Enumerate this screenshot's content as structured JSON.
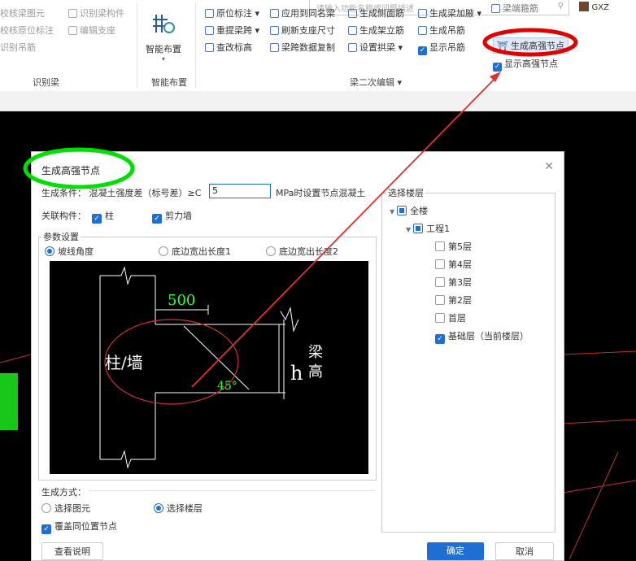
{
  "ribbon": {
    "search_placeholder": "请输入功能名称或问题描述",
    "user_label": "GXZ",
    "group_identify": {
      "items": [
        "校核梁图元",
        "识别梁构件",
        "校核原位标注",
        "编辑支座",
        "识别吊筋"
      ],
      "label": "识别梁"
    },
    "group_smart": {
      "button": "智能布置",
      "label": "智能布置"
    },
    "group_beam": {
      "row1": [
        "原位标注",
        "应用到同名梁",
        "生成侧面筋",
        "生成梁加腋",
        "梁端箍筋"
      ],
      "row1b": "生成高强节点",
      "row2": [
        "重提梁跨",
        "刷新支座尺寸",
        "生成架立筋",
        "生成吊筋"
      ],
      "row2b": "显示高强节点",
      "row3": [
        "查改标高",
        "梁跨数据复制",
        "设置拱梁",
        "显示吊筋"
      ],
      "label": "梁二次编辑"
    }
  },
  "dialog": {
    "title": "生成高强节点",
    "condition_label": "生成条件：  混凝土强度差（标号差）≥C",
    "condition_value": "5",
    "condition_suffix": "MPa时设置节点混凝土",
    "related_label": "关联构件：",
    "related_column": "柱",
    "related_wall": "剪力墙",
    "params_label": "参数设置",
    "opt_slope": "坡线角度",
    "opt_bottom1": "底边宽出长度1",
    "opt_bottom2": "底边宽出长度2",
    "diagram": {
      "dim_500": "500",
      "label_column": "柱/墙",
      "angle": "45°",
      "h": "h",
      "beam_height_1": "梁",
      "beam_height_2": "高"
    },
    "method_label": "生成方式：",
    "method_select_element": "选择图元",
    "method_select_floor": "选择楼层",
    "overwrite_label": "覆盖同位置节点",
    "help_button": "查看说明",
    "ok_button": "确定",
    "cancel_button": "取消",
    "floors_label": "选择楼层",
    "tree": {
      "all": "全楼",
      "project": "工程1",
      "floors": [
        {
          "label": "第5层",
          "checked": false
        },
        {
          "label": "第4层",
          "checked": false
        },
        {
          "label": "第3层",
          "checked": false
        },
        {
          "label": "第2层",
          "checked": false
        },
        {
          "label": "首层",
          "checked": false
        },
        {
          "label": "基础层（当前楼层）",
          "checked": true
        }
      ]
    }
  },
  "colors": {
    "accent": "#1e6ed3",
    "highlight_green": "#00e000",
    "highlight_red": "#e00000"
  }
}
